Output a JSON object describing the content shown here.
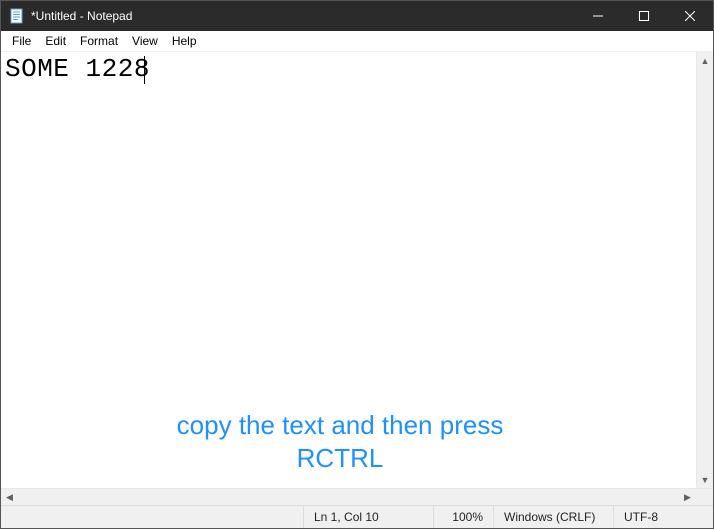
{
  "window": {
    "title": "*Untitled - Notepad"
  },
  "menu": {
    "file": "File",
    "edit": "Edit",
    "format": "Format",
    "view": "View",
    "help": "Help"
  },
  "editor": {
    "content": "SOME 1228"
  },
  "overlay": {
    "line1": "copy the text and then press",
    "line2": "RCTRL"
  },
  "status": {
    "position": "Ln 1, Col 10",
    "zoom": "100%",
    "line_ending": "Windows (CRLF)",
    "encoding": "UTF-8"
  }
}
